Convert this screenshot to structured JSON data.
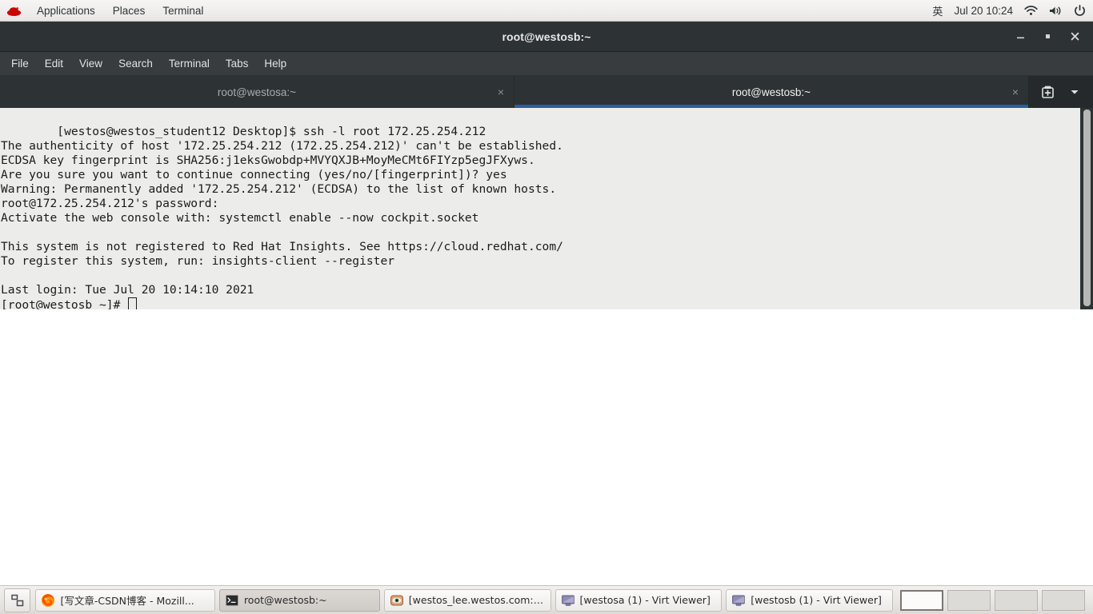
{
  "top_panel": {
    "logo": "redhat-logo",
    "menus": [
      "Applications",
      "Places",
      "Terminal"
    ],
    "ime": "英",
    "clock": "Jul 20  10:24",
    "tray": [
      "wifi-icon",
      "volume-icon",
      "power-icon"
    ]
  },
  "window": {
    "title": "root@westosb:~",
    "controls": {
      "minimize": "minimize-icon",
      "maximize": "maximize-icon",
      "close": "close-icon"
    },
    "menubar": [
      "File",
      "Edit",
      "View",
      "Search",
      "Terminal",
      "Tabs",
      "Help"
    ],
    "tabs": [
      {
        "label": "root@westosa:~",
        "active": false,
        "close": "×"
      },
      {
        "label": "root@westosb:~",
        "active": true,
        "close": "×"
      }
    ],
    "tab_actions": {
      "new_tab": "new-tab-icon",
      "tab_list": "chevron-down-icon"
    }
  },
  "terminal": {
    "lines": [
      "[westos@westos_student12 Desktop]$ ssh -l root 172.25.254.212",
      "The authenticity of host '172.25.254.212 (172.25.254.212)' can't be established.",
      "ECDSA key fingerprint is SHA256:j1eksGwobdp+MVYQXJB+MoyMeCMt6FIYzp5egJFXyws.",
      "Are you sure you want to continue connecting (yes/no/[fingerprint])? yes",
      "Warning: Permanently added '172.25.254.212' (ECDSA) to the list of known hosts.",
      "root@172.25.254.212's password:",
      "Activate the web console with: systemctl enable --now cockpit.socket",
      "",
      "This system is not registered to Red Hat Insights. See https://cloud.redhat.com/",
      "To register this system, run: insights-client --register",
      "",
      "Last login: Tue Jul 20 10:14:10 2021"
    ],
    "prompt": "[root@westosb ~]# ",
    "background": "#ececea",
    "foreground": "#1b1b1b"
  },
  "taskbar": {
    "show_desktop": "show-desktop-icon",
    "tasks": [
      {
        "label": "[写文章-CSDN博客 - Mozill...",
        "icon": "firefox-icon",
        "active": false
      },
      {
        "label": "root@westosb:~",
        "icon": "terminal-icon",
        "active": true
      },
      {
        "label": "[westos_lee.westos.com:8 …",
        "icon": "vnc-icon",
        "active": false
      },
      {
        "label": "[westosa (1) - Virt Viewer]",
        "icon": "display-icon",
        "active": false
      },
      {
        "label": "[westosb (1) - Virt Viewer]",
        "icon": "display-icon",
        "active": false
      }
    ],
    "workspaces": [
      {
        "active": true
      },
      {
        "active": false
      },
      {
        "active": false
      },
      {
        "active": false
      }
    ]
  },
  "colors": {
    "accent_tab": "#2a6099",
    "titlebar": "#2d3234",
    "menubar": "#383c3e",
    "panel": "#efedec"
  }
}
